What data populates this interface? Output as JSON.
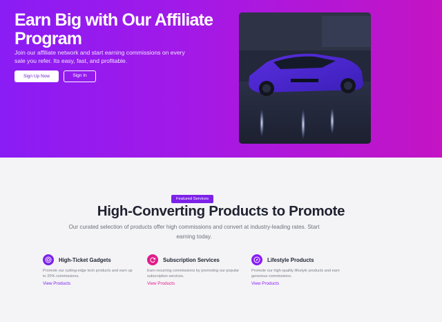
{
  "hero": {
    "title": "Earn Big with Our Affiliate Program",
    "subtitle": "Join our affiliate network and start earning commissions on every sale you refer. Its easy, fast, and profitable.",
    "primary_button": "Sign Up Now",
    "secondary_button": "Sign In"
  },
  "section": {
    "badge": "Featured Services",
    "title": "High-Converting Products to Promote",
    "subtitle": "Our curated selection of products offer high commissions and convert at industry-leading rates. Start earning today."
  },
  "cards": [
    {
      "icon": "target-icon",
      "title": "High-Ticket Gadgets",
      "description": "Promote our cutting-edge tech products and earn up to 20% commissions.",
      "link": "View Products",
      "accent": "#7c22e8"
    },
    {
      "icon": "refresh-icon",
      "title": "Subscription Services",
      "description": "Earn recurring commissions by promoting our popular subscription services.",
      "link": "View Products",
      "accent": "#e01d8a"
    },
    {
      "icon": "compass-icon",
      "title": "Lifestyle Products",
      "description": "Promote our high-quality lifestyle products and earn generous commissions.",
      "link": "View Products",
      "accent": "#8a1cf5"
    }
  ]
}
